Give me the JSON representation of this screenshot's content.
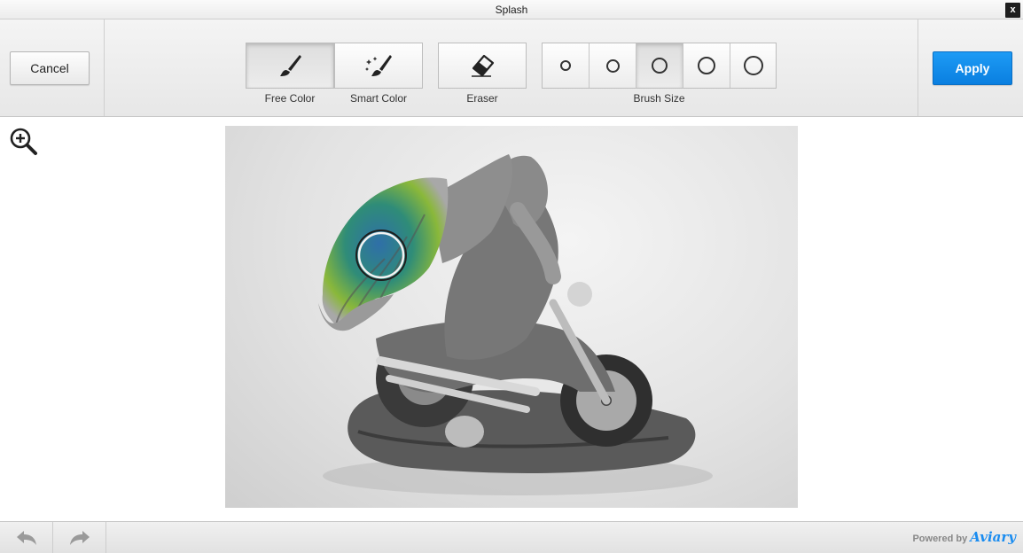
{
  "window": {
    "title": "Splash",
    "close_label": "x"
  },
  "toolbar": {
    "cancel_label": "Cancel",
    "apply_label": "Apply",
    "tools": [
      {
        "label": "Free Color",
        "icon": "paintbrush-icon",
        "active": true
      },
      {
        "label": "Smart Color",
        "icon": "magic-brush-icon",
        "active": false
      },
      {
        "label": "Eraser",
        "icon": "eraser-icon",
        "active": false
      }
    ],
    "brush_size_label": "Brush Size",
    "brush_sizes": [
      {
        "name": "brush-size-1",
        "active": false
      },
      {
        "name": "brush-size-2",
        "active": false
      },
      {
        "name": "brush-size-3",
        "active": true
      },
      {
        "name": "brush-size-4",
        "active": false
      },
      {
        "name": "brush-size-5",
        "active": false
      }
    ]
  },
  "workspace": {
    "zoom_icon": "zoom-in-icon",
    "image_subject": "grayscale photo of dragon riding motorcycle figurine with colored wing"
  },
  "footer": {
    "undo_icon": "undo-icon",
    "redo_icon": "redo-icon",
    "powered_by": "Powered by",
    "brand": "Aviary"
  },
  "colors": {
    "accent": "#1a8cf0",
    "apply_bg": "#0a7fe0"
  }
}
